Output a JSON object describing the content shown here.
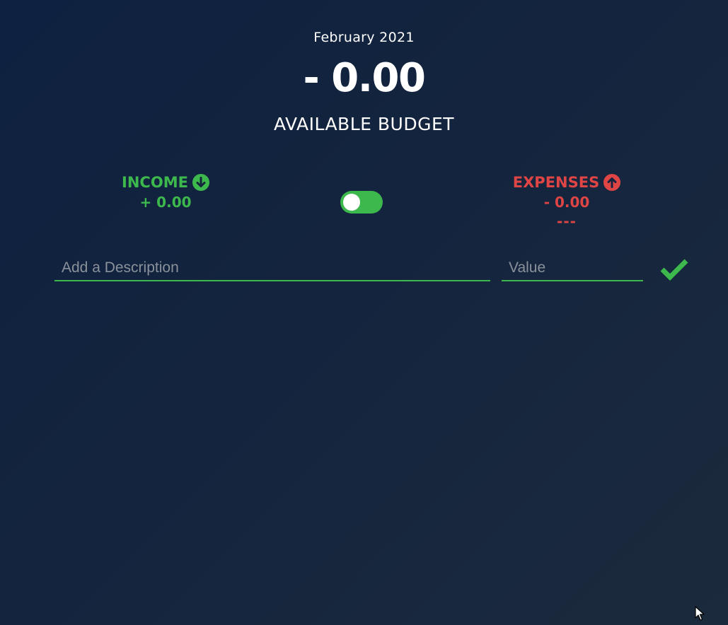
{
  "budget": {
    "month": "February 2021",
    "value": "- 0.00",
    "title": "AVAILABLE BUDGET"
  },
  "income": {
    "title": "INCOME",
    "value": "+ 0.00",
    "icon": "arrow-circle-down-icon",
    "color": "#3db84d"
  },
  "expenses": {
    "title": "EXPENSES",
    "value": "- 0.00",
    "percentage": "---",
    "icon": "arrow-circle-up-icon",
    "color": "#df4545"
  },
  "toggle": {
    "state": "on",
    "color": "#3db84d"
  },
  "form": {
    "description_placeholder": "Add a Description",
    "description_value": "",
    "value_placeholder": "Value",
    "value_value": "",
    "submit_icon": "checkmark-icon"
  }
}
